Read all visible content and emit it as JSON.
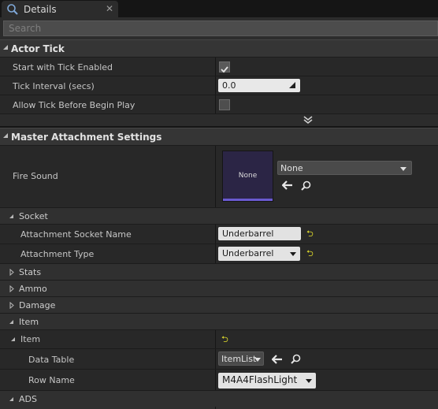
{
  "tab": {
    "title": "Details",
    "close": "✕"
  },
  "search": {
    "placeholder": "Search"
  },
  "actor_tick": {
    "header": "Actor Tick",
    "start_with_tick_label": "Start with Tick Enabled",
    "start_with_tick_checked": true,
    "tick_interval_label": "Tick Interval (secs)",
    "tick_interval_value": "0.0",
    "allow_tick_label": "Allow Tick Before Begin Play",
    "allow_tick_checked": false
  },
  "master": {
    "header": "Master Attachment Settings",
    "fire_sound_label": "Fire Sound",
    "fire_sound_thumb": "None",
    "fire_sound_combo": "None"
  },
  "socket": {
    "header": "Socket",
    "attachment_socket_label": "Attachment Socket Name",
    "attachment_socket_value": "Underbarrel",
    "attachment_type_label": "Attachment Type",
    "attachment_type_value": "Underbarrel"
  },
  "collapsed": {
    "stats": "Stats",
    "ammo": "Ammo",
    "damage": "Damage"
  },
  "item": {
    "header": "Item",
    "sub_header": "Item",
    "data_table_label": "Data Table",
    "data_table_value": "ItemList",
    "row_name_label": "Row Name",
    "row_name_value": "M4A4FlashLight"
  },
  "ads": {
    "header": "ADS"
  },
  "reset_glyph": "⮌",
  "colors": {
    "accent": "#6a5ad0",
    "reset": "#e0dc2c",
    "panel": "#282828",
    "header": "#353535"
  }
}
